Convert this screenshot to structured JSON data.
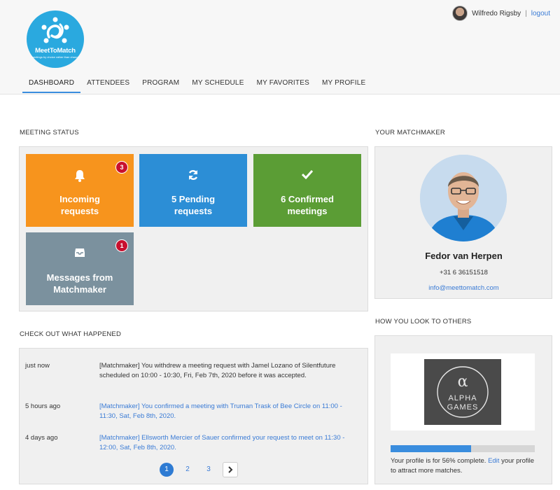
{
  "brand": {
    "name": "MeetToMatch",
    "tagline": "meetings by choice rather than chance",
    "color": "#2aa9df"
  },
  "user": {
    "name": "Wilfredo Rigsby",
    "separator": "|",
    "logout": "logout"
  },
  "nav": {
    "items": [
      {
        "label": "DASHBOARD",
        "active": true
      },
      {
        "label": "ATTENDEES"
      },
      {
        "label": "PROGRAM"
      },
      {
        "label": "MY SCHEDULE"
      },
      {
        "label": "MY FAVORITES"
      },
      {
        "label": "MY PROFILE"
      }
    ]
  },
  "meeting_status": {
    "title": "MEETING STATUS",
    "tiles": [
      {
        "label": "Incoming requests",
        "badge": "3",
        "color": "#f7941d",
        "icon": "bell-icon"
      },
      {
        "label": "5 Pending requests",
        "color": "#2c8ed6",
        "icon": "refresh-icon"
      },
      {
        "label": "6 Confirmed meetings",
        "color": "#5b9d35",
        "icon": "check-icon"
      },
      {
        "label": "Messages from Matchmaker",
        "badge": "1",
        "color": "#7b919e",
        "icon": "inbox-icon"
      }
    ]
  },
  "activity": {
    "title": "CHECK OUT WHAT HAPPENED",
    "items": [
      {
        "time": "just now",
        "text": "[Matchmaker] You withdrew a meeting request with Jamel Lozano of Silentfuture scheduled on 10:00 - 10:30, Fri, Feb 7th, 2020 before it was accepted."
      },
      {
        "time": "5 hours ago",
        "text": "[Matchmaker] You confirmed a meeting with Truman Trask of Bee Circle on 11:00 - 11:30, Sat, Feb 8th, 2020."
      },
      {
        "time": "4 days ago",
        "text": "[Matchmaker] Ellsworth Mercier of Sauer confirmed your request to meet on 11:30 - 12:00, Sat, Feb 8th, 2020."
      }
    ],
    "pages": [
      "1",
      "2",
      "3"
    ],
    "current_page": "1",
    "next_icon": "chevron-right-icon"
  },
  "matchmaker": {
    "title": "YOUR MATCHMAKER",
    "name": "Fedor van Herpen",
    "phone": "+31 6 36151518",
    "email": "info@meettomatch.com"
  },
  "profile": {
    "title": "HOW YOU LOOK TO OTHERS",
    "company_logo": {
      "symbol": "α",
      "line1": "ALPHA",
      "line2": "GAMES"
    },
    "completion": 0.56,
    "text_before": "Your profile is for 56% complete.",
    "edit_label": "Edit",
    "text_after": "your profile to attract more matches."
  }
}
